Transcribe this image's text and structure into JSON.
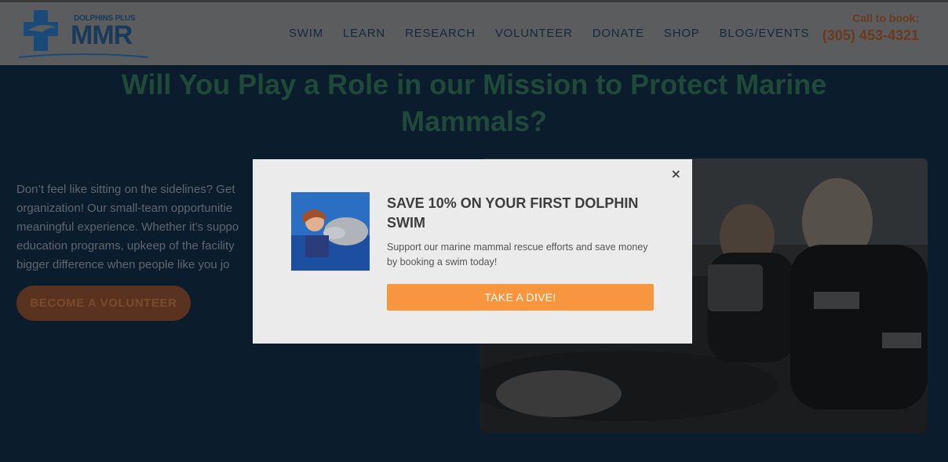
{
  "header": {
    "brand_top": "DOLPHINS PLUS",
    "brand_main": "MMR",
    "nav": [
      "SWIM",
      "LEARN",
      "RESEARCH",
      "VOLUNTEER",
      "DONATE",
      "SHOP",
      "BLOG/EVENTS"
    ],
    "call_label": "Call to book:",
    "phone": "(305) 453-4321"
  },
  "hero": {
    "title": "Will You Play a Role in our Mission to Protect Marine Mammals?",
    "body": [
      "Don’t feel like sitting on the sidelines? Get",
      "organization! Our small-team opportunitie",
      "meaningful experience. Whether it’s suppo",
      "education programs, upkeep of the facility",
      "bigger difference when people like you jo"
    ],
    "volunteer_button": "BECOME A VOLUNTEER"
  },
  "modal": {
    "close": "×",
    "heading": "SAVE 10% ON YOUR FIRST DOLPHIN SWIM",
    "subtext": "Support our marine mammal rescue efforts and save money by booking a swim today!",
    "cta": "TAKE A DIVE!"
  },
  "colors": {
    "accent": "#f7963f",
    "overlay": "#0b1c2d"
  }
}
